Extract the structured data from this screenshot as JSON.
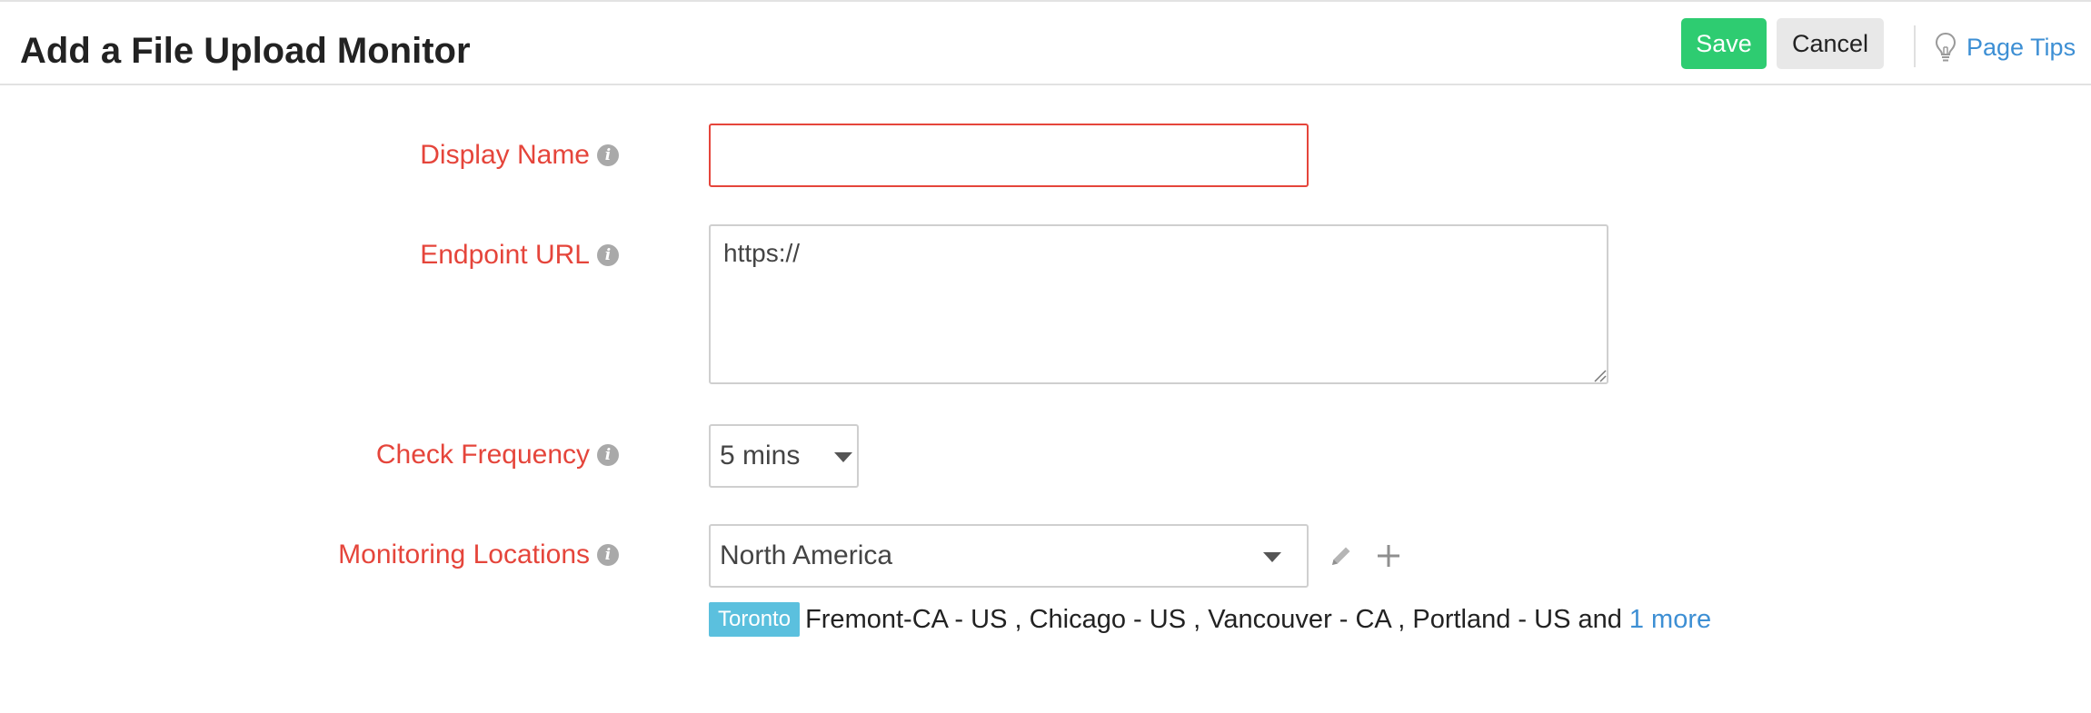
{
  "header": {
    "title": "Add a File Upload Monitor",
    "save_label": "Save",
    "cancel_label": "Cancel",
    "page_tips_label": "Page Tips"
  },
  "form": {
    "display_name": {
      "label": "Display Name",
      "value": "",
      "info_glyph": "i"
    },
    "endpoint_url": {
      "label": "Endpoint URL",
      "value": "https://",
      "info_glyph": "i"
    },
    "check_frequency": {
      "label": "Check Frequency",
      "selected": "5 mins",
      "info_glyph": "i"
    },
    "monitoring_locations": {
      "label": "Monitoring Locations",
      "selected": "North America",
      "info_glyph": "i",
      "primary_tag": "Toronto",
      "secondary_text": "Fremont-CA - US , Chicago - US , Vancouver - CA , Portland - US and",
      "more_link": "1 more"
    }
  },
  "colors": {
    "required_label": "#e5453b",
    "save_button": "#2ecc71",
    "link": "#3d8fd4",
    "tag": "#5bc0de"
  },
  "icons": [
    "info-icon",
    "lightbulb-icon",
    "caret-down-icon",
    "pencil-icon",
    "plus-icon"
  ]
}
